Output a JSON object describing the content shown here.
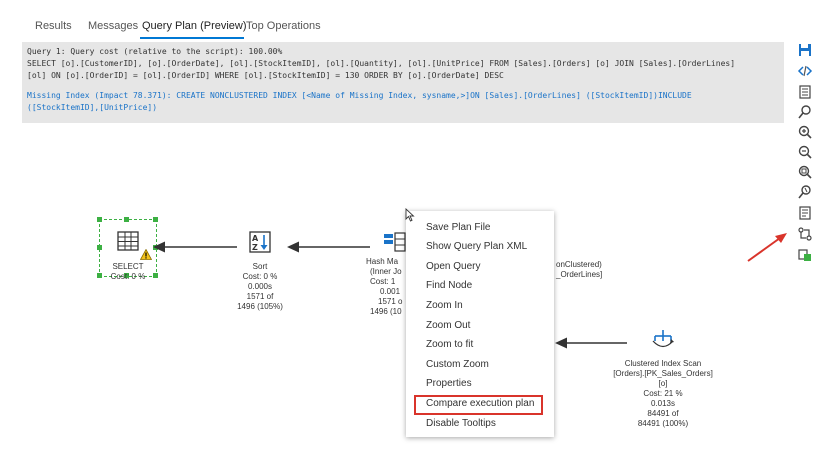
{
  "tabs": [
    {
      "label": "Results"
    },
    {
      "label": "Messages"
    },
    {
      "label": "Query Plan (Preview)",
      "active": true
    },
    {
      "label": "Top Operations"
    }
  ],
  "query": {
    "line1": "Query 1: Query cost (relative to the script): 100.00%",
    "line2": "SELECT [o].[CustomerID], [o].[OrderDate], [ol].[StockItemID], [ol].[Quantity], [ol].[UnitPrice] FROM [Sales].[Orders] [o] JOIN [Sales].[OrderLines]",
    "line3": "[ol] ON [o].[OrderID] = [ol].[OrderID] WHERE [ol].[StockItemID] = 130 ORDER BY [o].[OrderDate] DESC",
    "missing_index_1": "Missing Index (Impact 78.371): CREATE NONCLUSTERED INDEX [<Name of Missing Index, sysname,>]ON [Sales].[OrderLines] ([StockItemID])INCLUDE",
    "missing_index_2": "([StockItemID],[UnitPrice])"
  },
  "nodes": {
    "select": {
      "name": "SELECT",
      "cost": "Cost: 0 %"
    },
    "sort": {
      "name": "Sort",
      "cost": "Cost: 0 %",
      "time": "0.000s",
      "rows": "1571 of",
      "est": "1496 (105%)"
    },
    "hash": {
      "name": "Hash Ma",
      "sub": "(Inner Jo",
      "cost": "Cost: 1",
      "time": "0.001",
      "rows": "1571 o",
      "est": "1496 (10"
    },
    "partial": {
      "line1": "onClustered)",
      "line2": "_OrderLines]"
    },
    "clustered": {
      "name": "Clustered Index Scan",
      "table": "[Orders].[PK_Sales_Orders]",
      "alias": "[o]",
      "cost": "Cost: 21 %",
      "time": "0.013s",
      "rows": "84491 of",
      "est": "84491 (100%)"
    }
  },
  "context_menu": {
    "items": [
      "Save Plan File",
      "Show Query Plan XML",
      "Open Query",
      "Find Node",
      "Zoom In",
      "Zoom Out",
      "Zoom to fit",
      "Custom Zoom",
      "Properties",
      "Compare execution plan",
      "Disable Tooltips"
    ]
  },
  "toolbar": {
    "icons": [
      "save-icon",
      "xml-icon",
      "open-query-icon",
      "find-node-icon",
      "zoom-in-icon",
      "zoom-out-icon",
      "zoom-to-fit-icon",
      "custom-zoom-icon",
      "properties-icon",
      "compare-plan-icon",
      "toggle-tooltips-icon"
    ]
  },
  "colors": {
    "accent": "#0078d4",
    "highlight": "#d9342b",
    "selection": "#3cb043",
    "missing_index": "#1a73c8"
  }
}
